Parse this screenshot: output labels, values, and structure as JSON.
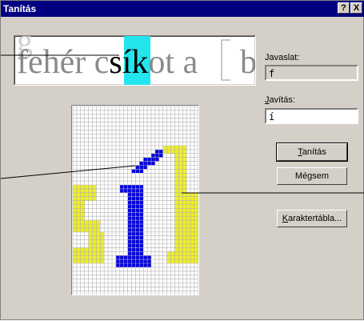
{
  "window": {
    "title": "Tanítás",
    "help_label": "?",
    "close_label": "X"
  },
  "preview": {
    "ghost_text": "g",
    "before": "fehér c",
    "current": "sík",
    "after": "ot a",
    "tail": "b"
  },
  "suggestion": {
    "label": "Javaslat:",
    "value": "f"
  },
  "correction": {
    "label_prefix": "",
    "label_accel": "J",
    "label_rest": "avítás:",
    "value": "í"
  },
  "buttons": {
    "teach": {
      "accel": "T",
      "rest": "anítás"
    },
    "cancel": "Mégsem",
    "charmap": {
      "accel": "K",
      "rest": "araktertábla..."
    }
  },
  "glyph_editor": {
    "colors": {
      "grid_line": "#b0b0b0",
      "current_glyph": "#0000e0",
      "neighbor_glyph": "#f0f020"
    }
  }
}
